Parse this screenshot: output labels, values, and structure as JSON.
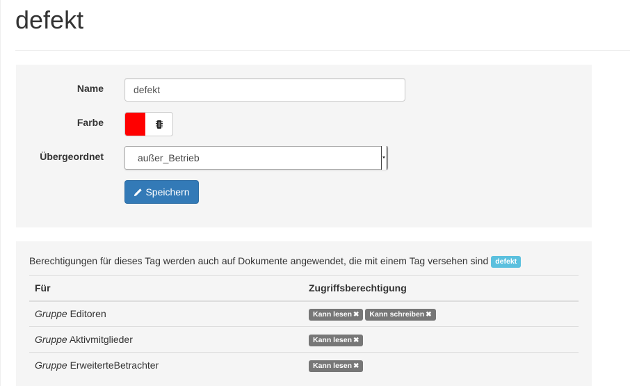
{
  "page": {
    "title": "defekt"
  },
  "form": {
    "name_label": "Name",
    "name_value": "defekt",
    "color_label": "Farbe",
    "color_value": "#ff0000",
    "parent_label": "Übergeordnet",
    "parent_value": "außer_Betrieb",
    "save_label": "Speichern",
    "save_icon": "pencil-icon",
    "color_addon_icon": "chip-icon"
  },
  "permissions": {
    "intro": "Berechtigungen für dieses Tag werden auch auf Dokumente angewendet, die mit einem Tag versehen sind",
    "tag": "defekt",
    "columns": {
      "for": "Für",
      "access": "Zugriffsberechtigung"
    },
    "rows": [
      {
        "type": "Gruppe",
        "name": "Editoren",
        "rights": [
          "Kann lesen",
          "Kann schreiben"
        ]
      },
      {
        "type": "Gruppe",
        "name": "Aktivmitglieder",
        "rights": [
          "Kann lesen"
        ]
      },
      {
        "type": "Gruppe",
        "name": "ErweiterteBetrachter",
        "rights": [
          "Kann lesen"
        ]
      }
    ],
    "remove_icon": "remove-icon",
    "colors": {
      "tag": "#5bc0de",
      "right_label": "#777777"
    }
  }
}
